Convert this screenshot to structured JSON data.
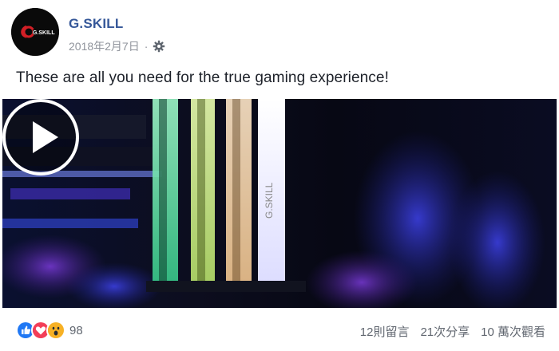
{
  "post": {
    "page_name": "G.SKILL",
    "date": "2018年2月7日",
    "separator": "·",
    "privacy_icon": "gear-icon",
    "text": "These are all you need for the true gaming experience!",
    "avatar_logo_text": "G.SKILL"
  },
  "video": {
    "play_icon": "play-icon",
    "module_text": "G.SKILL"
  },
  "footer": {
    "reaction_icons": [
      "like-icon",
      "love-icon",
      "wow-icon"
    ],
    "reaction_count": "98",
    "comments": "12則留言",
    "shares": "21次分享",
    "views": "10 萬次觀看"
  },
  "colors": {
    "page_name": "#365899",
    "meta": "#90949c",
    "text": "#1d2129",
    "like": "#2078f4",
    "love": "#f33e58",
    "wow": "#f7b125"
  }
}
